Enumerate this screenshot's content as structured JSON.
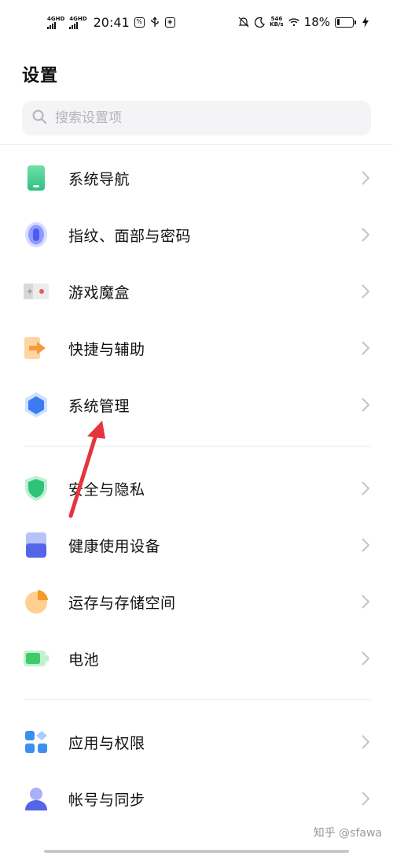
{
  "status_bar": {
    "net1": "4GHD",
    "net2": "4GHD",
    "time": "20:41",
    "speed_value": "546",
    "speed_unit": "KB/s",
    "battery_text": "18%",
    "battery_level": 0.18
  },
  "page": {
    "title": "设置"
  },
  "search": {
    "placeholder": "搜索设置项"
  },
  "items": [
    {
      "label": "系统导航",
      "icon": "phone-navigation-icon"
    },
    {
      "label": "指纹、面部与密码",
      "icon": "fingerprint-icon"
    },
    {
      "label": "游戏魔盒",
      "icon": "game-box-icon"
    },
    {
      "label": "快捷与辅助",
      "icon": "shortcut-arrow-icon"
    },
    {
      "label": "系统管理",
      "icon": "system-hexagon-icon"
    },
    {
      "label": "安全与隐私",
      "icon": "shield-icon"
    },
    {
      "label": "健康使用设备",
      "icon": "health-device-icon"
    },
    {
      "label": "运存与存储空间",
      "icon": "storage-pie-icon"
    },
    {
      "label": "电池",
      "icon": "battery-icon"
    },
    {
      "label": "应用与权限",
      "icon": "apps-grid-icon"
    },
    {
      "label": "帐号与同步",
      "icon": "account-user-icon"
    }
  ],
  "watermark": "知乎 @sfawa",
  "colors": {
    "annotation_arrow": "#e5343d",
    "chevron": "#c4c4c8"
  }
}
